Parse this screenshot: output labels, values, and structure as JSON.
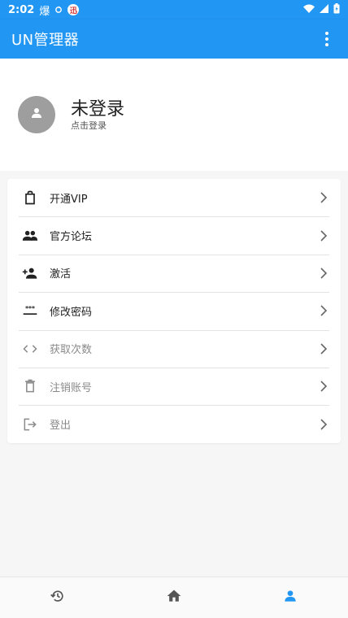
{
  "status_bar": {
    "time": "2:02",
    "notification_glyph": "爆",
    "network_badge": "迅",
    "icons": [
      "sync-icon",
      "wifi-icon",
      "signal-icon",
      "battery-charging-icon"
    ]
  },
  "app_bar": {
    "title": "UN管理器",
    "menu_icon": "more-vert-icon"
  },
  "profile": {
    "name": "未登录",
    "subtitle": "点击登录",
    "avatar_icon": "person-icon"
  },
  "menu": {
    "items": [
      {
        "label": "开通VIP",
        "icon": "shopping-bag-icon",
        "dim": false
      },
      {
        "label": "官方论坛",
        "icon": "people-icon",
        "dim": false
      },
      {
        "label": "激活",
        "icon": "person-add-icon",
        "dim": false
      },
      {
        "label": "修改密码",
        "icon": "password-icon",
        "dim": false
      },
      {
        "label": "获取次数",
        "icon": "code-icon",
        "dim": true
      },
      {
        "label": "注销账号",
        "icon": "trash-icon",
        "dim": true
      },
      {
        "label": "登出",
        "icon": "logout-icon",
        "dim": true
      }
    ]
  },
  "bottom_nav": {
    "tabs": [
      {
        "icon": "history-icon",
        "active": false
      },
      {
        "icon": "home-icon",
        "active": false
      },
      {
        "icon": "person-icon",
        "active": true
      }
    ]
  },
  "colors": {
    "primary": "#2196f3",
    "active_tab": "#2196f3",
    "inactive_tab": "#555555",
    "avatar_bg": "#9e9e9e"
  }
}
